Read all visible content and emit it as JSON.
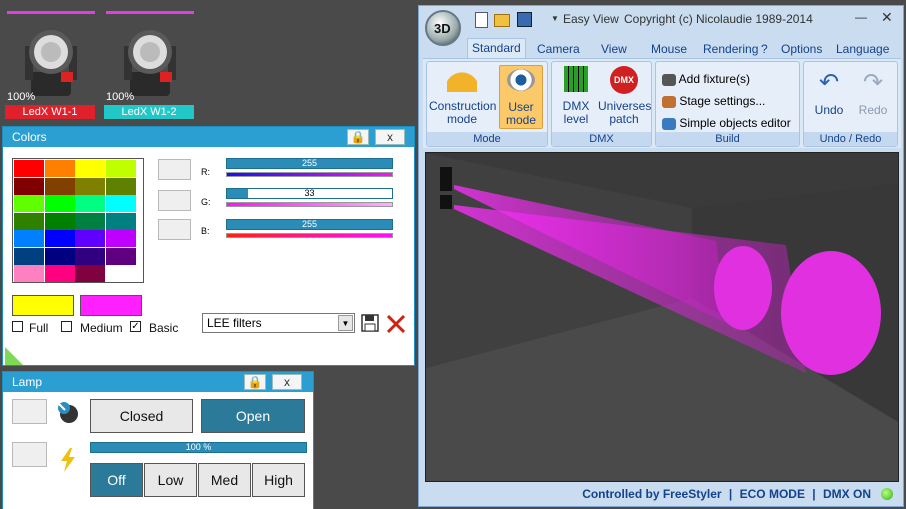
{
  "fixtures": [
    {
      "pct": "100%",
      "name": "LedX W1-1",
      "name_color": "#e0202a"
    },
    {
      "pct": "100%",
      "name": "LedX W1-2",
      "name_color": "#22c8c8"
    }
  ],
  "colors_panel": {
    "title": "Colors",
    "lock_icon": "lock-icon",
    "close_label": "x",
    "swatches": [
      [
        "#ff0000",
        "#ff8000",
        "#ffff00",
        "#c0ff00"
      ],
      [
        "#800000",
        "#804000",
        "#808000",
        "#608000"
      ],
      [
        "#60ff00",
        "#00ff00",
        "#00ff80",
        "#00ffff"
      ],
      [
        "#308000",
        "#008000",
        "#008040",
        "#008080"
      ],
      [
        "#0080ff",
        "#0000ff",
        "#6000ff",
        "#c000ff"
      ],
      [
        "#004080",
        "#000080",
        "#300080",
        "#600080"
      ],
      [
        "#ff80c0",
        "#ff0080",
        "#800040",
        "#ffffff"
      ]
    ],
    "r_label": "R:",
    "g_label": "G:",
    "b_label": "B:",
    "r_value": "255",
    "g_value": "33",
    "b_value": "255",
    "r_level": 1.0,
    "g_level": 0.13,
    "b_level": 1.0,
    "color_a": "#ffff00",
    "color_b": "#ff20ff",
    "full_label": "Full",
    "medium_label": "Medium",
    "basic_label": "Basic",
    "basic_checked": "✓",
    "filter_value": "LEE filters"
  },
  "lamp_panel": {
    "title": "Lamp",
    "close_label": "x",
    "closed_label": "Closed",
    "open_label": "Open",
    "dimmer_value": "100 %",
    "dimmer_level": 1.0,
    "off_label": "Off",
    "low_label": "Low",
    "med_label": "Med",
    "high_label": "High"
  },
  "window": {
    "title_mode": "Easy View",
    "copyright": "Copyright (c) Nicolaudie 1989-2014",
    "logo_text": "3D",
    "tabs": [
      "Standard",
      "Camera",
      "View",
      "Mouse",
      "Rendering",
      "?",
      "Options",
      "Language"
    ],
    "groups": {
      "mode": "Mode",
      "dmx": "DMX",
      "build": "Build",
      "undo_redo": "Undo / Redo"
    },
    "buttons": {
      "construction_mode": "Construction mode",
      "user_mode": "User mode",
      "dmx_level": "DMX level",
      "universes_patch": "Universes patch",
      "add_fixture": "Add fixture(s)",
      "stage_settings": "Stage settings...",
      "simple_objects_editor": "Simple objects editor",
      "undo": "Undo",
      "redo": "Redo"
    },
    "status": {
      "controlled_by": "Controlled by FreeStyler",
      "eco_mode": "ECO MODE",
      "dmx_on": "DMX ON",
      "separator": "|"
    }
  }
}
